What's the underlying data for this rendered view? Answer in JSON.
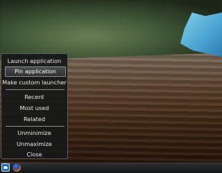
{
  "menu": {
    "launch_label": "Launch application",
    "pin_label": "Pin application",
    "custom_launcher_label": "Make custom launcher",
    "recent_label": "Recent",
    "most_used_label": "Most used",
    "related_label": "Related",
    "unminimize_label": "Unminimize",
    "unmaximize_label": "Unmaximize",
    "close_label": "Close"
  },
  "taskbar": {
    "icons": [
      "dolphin-file-manager-icon",
      "firefox-icon"
    ]
  },
  "colors": {
    "menu_bg": "#161818",
    "menu_text": "#eaeaea",
    "highlight_border": "#8b8e92"
  }
}
